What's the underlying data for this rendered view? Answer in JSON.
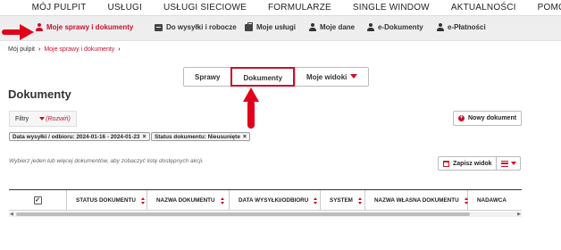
{
  "top_nav": [
    "MÓJ PULPIT",
    "USŁUGI",
    "USŁUGI SIECIOWE",
    "FORMULARZE",
    "SINGLE WINDOW",
    "AKTUALNOŚCI",
    "POMOC"
  ],
  "sub_nav": [
    {
      "label": "Moje sprawy i dokumenty",
      "icon": "user-icon",
      "active": true
    },
    {
      "label": "Do wysyłki i robocze",
      "icon": "box-icon"
    },
    {
      "label": "Moje usługi",
      "icon": "bag-icon"
    },
    {
      "label": "Moje dane",
      "icon": "user-icon"
    },
    {
      "label": "e-Dokumenty",
      "icon": "user-icon"
    },
    {
      "label": "e-Płatności",
      "icon": "user-icon"
    }
  ],
  "breadcrumb": {
    "home": "Mój pulpit",
    "current": "Moje sprawy i dokumenty"
  },
  "tabs": [
    {
      "label": "Sprawy"
    },
    {
      "label": "Dokumenty",
      "active": true
    },
    {
      "label": "Moje widoki",
      "dropdown": true
    }
  ],
  "page_title": "Dokumenty",
  "filters": {
    "label": "Filtry",
    "expand": "(Rozwiń)"
  },
  "new_document": "Nowy dokument",
  "chips": [
    "Data wysyłki / odbioru: 2024-01-16 - 2024-01-23",
    "Status dokumentu: Nieusunięte"
  ],
  "hint": "Wybierz jeden lub więcej dokumentów, aby zobaczyć listę dostępnych akcji.",
  "save_view": "Zapisz widok",
  "table": {
    "columns": [
      "STATUS DOKUMENTU",
      "NAZWA DOKUMENTU",
      "DATA WYSYŁKI/ODBIORU",
      "SYSTEM",
      "NAZWA WŁASNA DOKUMENTU",
      "NADAWCA"
    ]
  },
  "colors": {
    "accent": "#c8102e",
    "subnav_bg": "#eeeeee"
  }
}
